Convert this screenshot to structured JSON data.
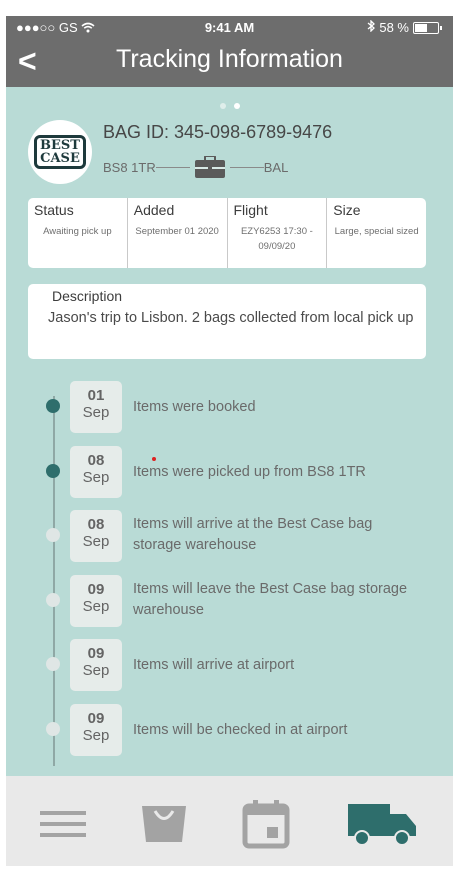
{
  "status_bar": {
    "carrier": "●●●○○ GS",
    "time": "9:41 AM",
    "battery_text": "58 %",
    "battery_level": 0.58
  },
  "header": {
    "title": "Tracking Information",
    "back": "<"
  },
  "pager": {
    "count": 2,
    "active": 1
  },
  "bag": {
    "logo_line1": "BEST",
    "logo_line2": "CASE",
    "id": "BAG ID: 345-098-6789-9476",
    "from": "BS8 1TR",
    "to": "BAL"
  },
  "info": {
    "status_label": "Status",
    "status_value": "Awaiting pick up",
    "added_label": "Added",
    "added_value": "September 01 2020",
    "flight_label": "Flight",
    "flight_value": "EZY6253 17:30 - 09/09/20",
    "size_label": "Size",
    "size_value": "Large, special sized"
  },
  "description": {
    "label": "Description",
    "text": "Jason's trip to Lisbon. 2 bags collected from local pick up"
  },
  "timeline": [
    {
      "day": "01",
      "month": "Sep",
      "text": "Items were booked",
      "done": true
    },
    {
      "day": "08",
      "month": "Sep",
      "text": "Items were picked up from BS8 1TR",
      "done": true
    },
    {
      "day": "08",
      "month": "Sep",
      "text": "Items will arrive at the Best Case bag storage warehouse",
      "done": false
    },
    {
      "day": "09",
      "month": "Sep",
      "text": "Items will leave the Best Case bag storage warehouse",
      "done": false
    },
    {
      "day": "09",
      "month": "Sep",
      "text": "Items will arrive at airport",
      "done": false
    },
    {
      "day": "09",
      "month": "Sep",
      "text": "Items will be checked in at airport",
      "done": false
    }
  ],
  "colors": {
    "background": "#b9dbd6",
    "topbar": "#6d6d6d",
    "accent": "#2e6e6c",
    "inactive_icon": "#a3a3a3"
  },
  "bottom_nav": [
    {
      "icon": "menu-icon",
      "active": false
    },
    {
      "icon": "shopping-bag-icon",
      "active": false
    },
    {
      "icon": "calendar-icon",
      "active": false
    },
    {
      "icon": "delivery-truck-icon",
      "active": true
    }
  ]
}
